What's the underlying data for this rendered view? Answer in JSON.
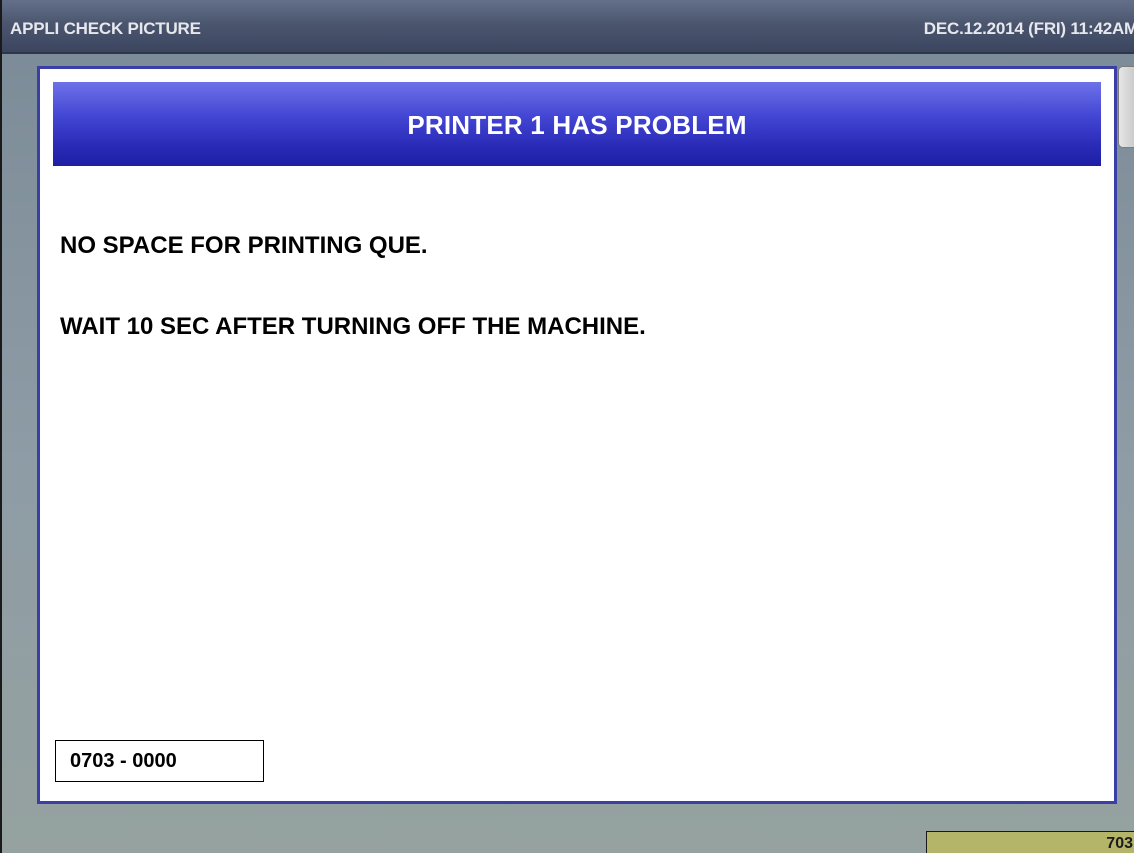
{
  "title_bar": {
    "app_title": "APPLI CHECK PICTURE",
    "datetime": "DEC.12.2014 (FRI)  11:42AM"
  },
  "dialog": {
    "title": "PRINTER 1 HAS PROBLEM",
    "messages": [
      "NO SPACE FOR PRINTING QUE.",
      "WAIT 10 SEC AFTER TURNING OFF THE MACHINE."
    ],
    "error_code": "0703 - 0000"
  },
  "status": {
    "value": "703"
  },
  "colors": {
    "title_bar": "#4b566e",
    "dialog_header": "#2a2cb8",
    "dialog_border": "#3a3fa8",
    "background": "#8e9ca6",
    "status_field": "#b5b56a"
  }
}
